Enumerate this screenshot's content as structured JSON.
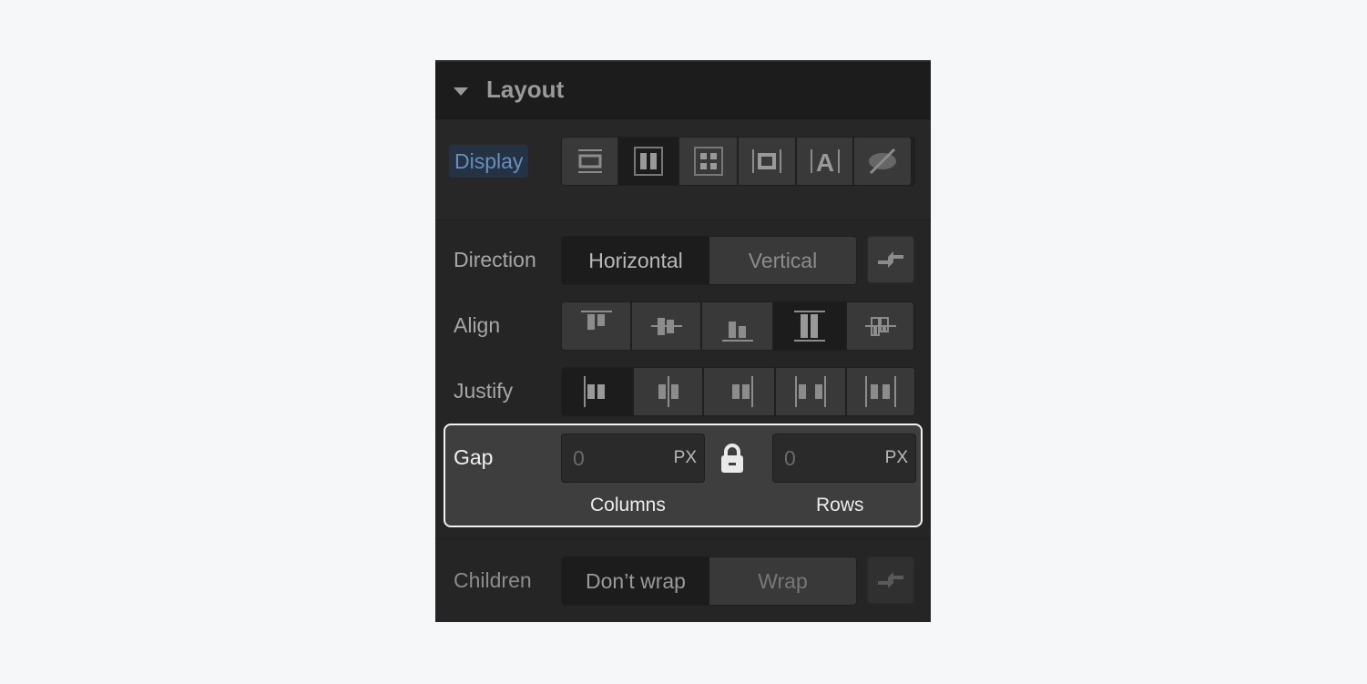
{
  "panel": {
    "title": "Layout",
    "display": {
      "label": "Display",
      "options": [
        {
          "icon": "display-block-icon",
          "active": false
        },
        {
          "icon": "display-flex-icon",
          "active": true
        },
        {
          "icon": "display-grid-icon",
          "active": false
        },
        {
          "icon": "display-inline-block-icon",
          "active": false
        },
        {
          "icon": "display-inline-icon",
          "active": false
        },
        {
          "icon": "display-none-icon",
          "active": false
        }
      ]
    },
    "direction": {
      "label": "Direction",
      "options": [
        "Horizontal",
        "Vertical"
      ],
      "selected": "Horizontal",
      "reverse_icon": "reverse-arrows-icon"
    },
    "align": {
      "label": "Align",
      "options": [
        {
          "icon": "align-start-icon",
          "active": false
        },
        {
          "icon": "align-center-icon",
          "active": false
        },
        {
          "icon": "align-end-icon",
          "active": false
        },
        {
          "icon": "align-stretch-icon",
          "active": true
        },
        {
          "icon": "align-baseline-icon",
          "active": false
        }
      ]
    },
    "justify": {
      "label": "Justify",
      "options": [
        {
          "icon": "justify-start-icon",
          "active": true
        },
        {
          "icon": "justify-center-icon",
          "active": false
        },
        {
          "icon": "justify-end-icon",
          "active": false
        },
        {
          "icon": "justify-space-between-icon",
          "active": false
        },
        {
          "icon": "justify-space-around-icon",
          "active": false
        }
      ]
    },
    "gap": {
      "label": "Gap",
      "columns": {
        "value": "0",
        "unit": "PX",
        "label": "Columns"
      },
      "rows": {
        "value": "0",
        "unit": "PX",
        "label": "Rows"
      },
      "lock_icon": "lock-icon"
    },
    "children": {
      "label": "Children",
      "options": [
        "Don’t wrap",
        "Wrap"
      ],
      "selected": "Don’t wrap",
      "reverse_icon": "reverse-arrows-icon"
    }
  },
  "colors": {
    "page_bg": "#f6f7f9",
    "panel_bg": "#252525",
    "display_label_bg": "#243244",
    "display_label_text": "#6b8fbd",
    "highlight_border": "#f2f2f2"
  }
}
